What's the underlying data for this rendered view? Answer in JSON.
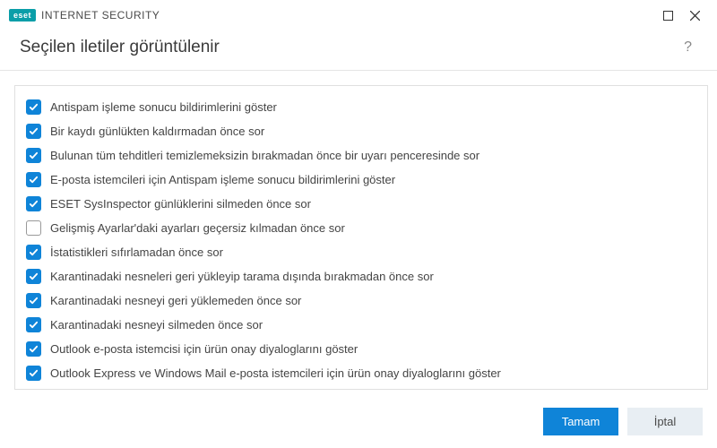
{
  "titlebar": {
    "logo": "eset",
    "app": "INTERNET SECURITY"
  },
  "header": {
    "title": "Seçilen iletiler görüntülenir",
    "help": "?"
  },
  "items": [
    {
      "checked": true,
      "label": "Antispam işleme sonucu bildirimlerini göster"
    },
    {
      "checked": true,
      "label": "Bir kaydı günlükten kaldırmadan önce sor"
    },
    {
      "checked": true,
      "label": "Bulunan tüm tehditleri temizlemeksizin bırakmadan önce bir uyarı penceresinde sor"
    },
    {
      "checked": true,
      "label": "E-posta istemcileri için Antispam işleme sonucu bildirimlerini göster"
    },
    {
      "checked": true,
      "label": "ESET SysInspector günlüklerini silmeden önce sor"
    },
    {
      "checked": false,
      "label": "Gelişmiş Ayarlar'daki ayarları geçersiz kılmadan önce sor"
    },
    {
      "checked": true,
      "label": "İstatistikleri sıfırlamadan önce sor"
    },
    {
      "checked": true,
      "label": "Karantinadaki nesneleri geri yükleyip tarama dışında bırakmadan önce sor"
    },
    {
      "checked": true,
      "label": "Karantinadaki nesneyi geri yüklemeden önce sor"
    },
    {
      "checked": true,
      "label": "Karantinadaki nesneyi silmeden önce sor"
    },
    {
      "checked": true,
      "label": "Outlook e-posta istemcisi için ürün onay diyaloglarını göster"
    },
    {
      "checked": true,
      "label": "Outlook Express ve Windows Mail e-posta istemcileri için ürün onay diyaloglarını göster"
    }
  ],
  "footer": {
    "ok": "Tamam",
    "cancel": "İptal"
  }
}
